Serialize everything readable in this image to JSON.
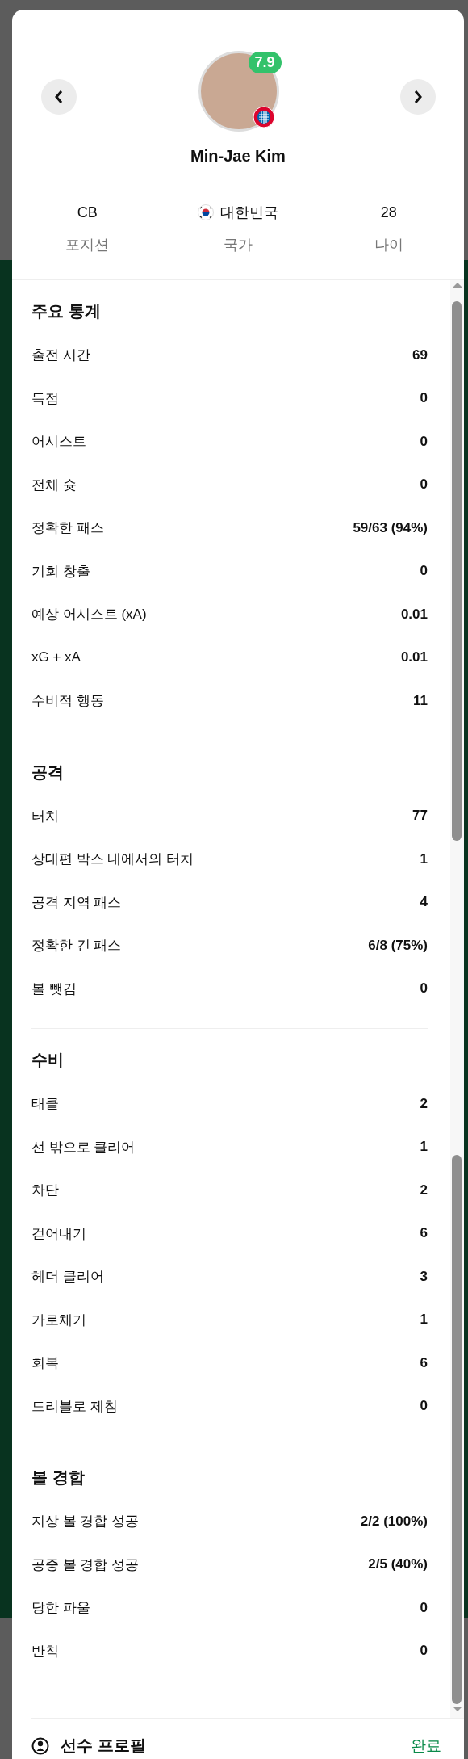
{
  "player": {
    "name": "Min-Jae Kim",
    "rating": "7.9"
  },
  "info": [
    {
      "kind": "text",
      "value": "CB",
      "label": "포지션"
    },
    {
      "kind": "country",
      "value": "대한민국",
      "label": "국가"
    },
    {
      "kind": "text",
      "value": "28",
      "label": "나이"
    }
  ],
  "sections": [
    {
      "title": "주요 통계",
      "rows": [
        {
          "label": "출전 시간",
          "value": "69"
        },
        {
          "label": "득점",
          "value": "0"
        },
        {
          "label": "어시스트",
          "value": "0"
        },
        {
          "label": "전체 슛",
          "value": "0"
        },
        {
          "label": "정확한 패스",
          "value": "59/63 (94%)"
        },
        {
          "label": "기회 창출",
          "value": "0"
        },
        {
          "label": "예상 어시스트 (xA)",
          "value": "0.01"
        },
        {
          "label": "xG + xA",
          "value": "0.01"
        },
        {
          "label": "수비적 행동",
          "value": "11"
        }
      ]
    },
    {
      "title": "공격",
      "rows": [
        {
          "label": "터치",
          "value": "77"
        },
        {
          "label": "상대편 박스 내에서의 터치",
          "value": "1"
        },
        {
          "label": "공격 지역 패스",
          "value": "4"
        },
        {
          "label": "정확한 긴 패스",
          "value": "6/8 (75%)"
        },
        {
          "label": "볼 뺏김",
          "value": "0"
        }
      ]
    },
    {
      "title": "수비",
      "rows": [
        {
          "label": "태클",
          "value": "2"
        },
        {
          "label": "선 밖으로 클리어",
          "value": "1"
        },
        {
          "label": "차단",
          "value": "2"
        },
        {
          "label": "걷어내기",
          "value": "6"
        },
        {
          "label": "헤더 클리어",
          "value": "3"
        },
        {
          "label": "가로채기",
          "value": "1"
        },
        {
          "label": "회복",
          "value": "6"
        },
        {
          "label": "드리블로 제침",
          "value": "0"
        }
      ]
    },
    {
      "title": "볼 경합",
      "rows": [
        {
          "label": "지상 볼 경합 성공",
          "value": "2/2 (100%)"
        },
        {
          "label": "공중 볼 경합 성공",
          "value": "2/5 (40%)"
        },
        {
          "label": "당한 파울",
          "value": "0"
        },
        {
          "label": "반칙",
          "value": "0"
        }
      ]
    }
  ],
  "footer": {
    "title": "선수 프로필",
    "action": "완료"
  }
}
